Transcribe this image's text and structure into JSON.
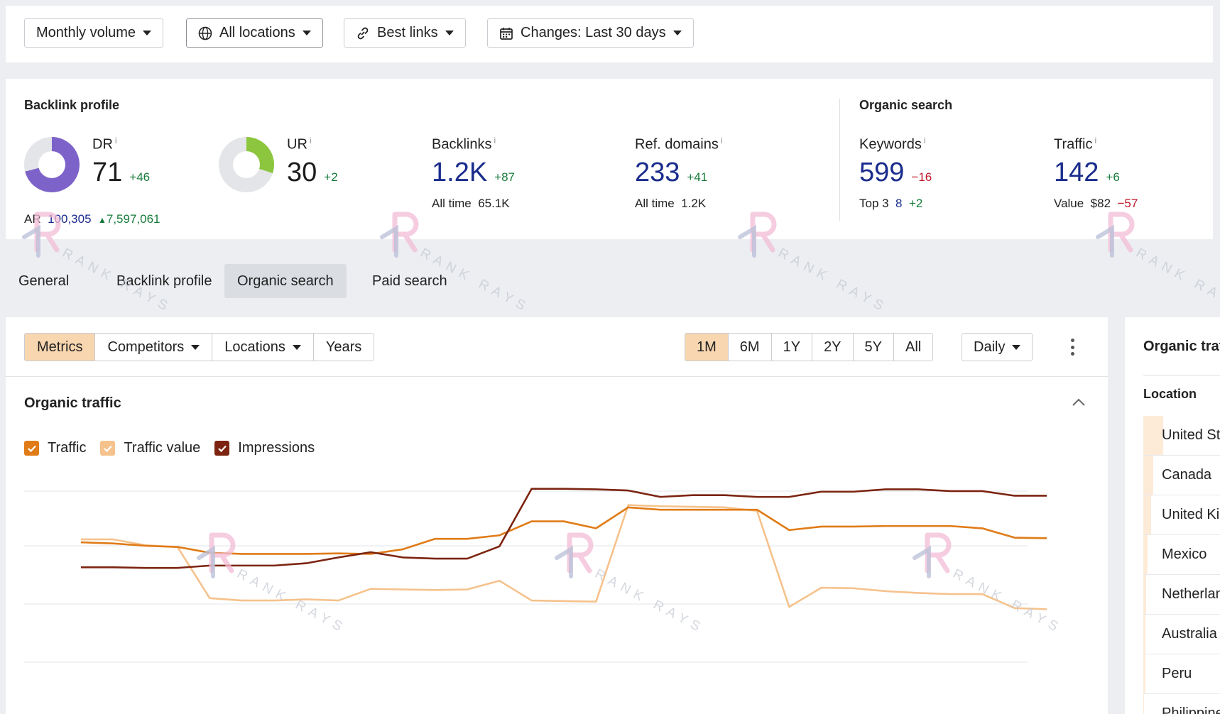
{
  "filters": {
    "volume": "Monthly volume",
    "locations": "All locations",
    "links": "Best links",
    "changes": "Changes: Last 30 days"
  },
  "backlink_profile": {
    "title": "Backlink profile",
    "dr": {
      "label": "DR",
      "value": "71",
      "delta": "+46",
      "fraction": 0.71,
      "color": "#7d63c9"
    },
    "ar": {
      "label": "AR",
      "value": "100,305",
      "delta": "7,597,061"
    },
    "ur": {
      "label": "UR",
      "value": "30",
      "delta": "+2",
      "fraction": 0.3,
      "color": "#8cc63f"
    },
    "backlinks": {
      "label": "Backlinks",
      "value": "1.2K",
      "delta": "+87",
      "sub_label": "All time",
      "sub_value": "65.1K"
    },
    "ref_domains": {
      "label": "Ref. domains",
      "value": "233",
      "delta": "+41",
      "sub_label": "All time",
      "sub_value": "1.2K"
    }
  },
  "organic_search": {
    "title": "Organic search",
    "keywords": {
      "label": "Keywords",
      "value": "599",
      "delta": "−16",
      "sub_label": "Top 3",
      "sub_value": "8",
      "sub_delta": "+2"
    },
    "traffic": {
      "label": "Traffic",
      "value": "142",
      "delta": "+6",
      "sub_label": "Value",
      "sub_value": "$82",
      "sub_delta": "−57"
    }
  },
  "tabs": [
    {
      "label": "General"
    },
    {
      "label": "Backlink profile"
    },
    {
      "label": "Organic search",
      "active": true
    },
    {
      "label": "Paid search"
    }
  ],
  "toolbar": {
    "views": [
      "Metrics",
      "Competitors",
      "Locations",
      "Years"
    ],
    "ranges": [
      "1M",
      "6M",
      "1Y",
      "2Y",
      "5Y",
      "All"
    ],
    "interval": "Daily"
  },
  "organic_traffic": {
    "title": "Organic traffic",
    "legend": [
      {
        "label": "Traffic",
        "color": "#e07b17"
      },
      {
        "label": "Traffic value",
        "color": "#f5c28c"
      },
      {
        "label": "Impressions",
        "color": "#7c2410"
      }
    ]
  },
  "chart_data": {
    "type": "line",
    "x": [
      1,
      2,
      3,
      4,
      5,
      6,
      7,
      8,
      9,
      10,
      11,
      12,
      13,
      14,
      15,
      16,
      17,
      18,
      19,
      20,
      21,
      22,
      23,
      24,
      25,
      26,
      27,
      28,
      29,
      30,
      31
    ],
    "ylim": [
      0,
      3
    ],
    "grid": true,
    "series": [
      {
        "name": "Traffic",
        "color": "#e07b17",
        "values": [
          2.06,
          2.04,
          2.0,
          1.98,
          1.88,
          1.86,
          1.86,
          1.86,
          1.87,
          1.86,
          1.94,
          2.12,
          2.12,
          2.18,
          2.42,
          2.42,
          2.3,
          2.66,
          2.62,
          2.62,
          2.62,
          2.62,
          2.27,
          2.33,
          2.33,
          2.34,
          2.34,
          2.34,
          2.3,
          2.14,
          2.13
        ]
      },
      {
        "name": "Traffic value",
        "color": "#f5c28c",
        "values": [
          2.11,
          2.11,
          2.01,
          1.98,
          1.1,
          1.06,
          1.06,
          1.08,
          1.06,
          1.26,
          1.25,
          1.24,
          1.25,
          1.4,
          1.06,
          1.05,
          1.04,
          2.7,
          2.68,
          2.67,
          2.66,
          2.6,
          0.95,
          1.28,
          1.27,
          1.22,
          1.19,
          1.17,
          1.17,
          0.93,
          0.91
        ]
      },
      {
        "name": "Impressions",
        "color": "#7c2410",
        "values": [
          1.63,
          1.63,
          1.62,
          1.62,
          1.66,
          1.66,
          1.66,
          1.7,
          1.8,
          1.89,
          1.8,
          1.78,
          1.78,
          1.99,
          2.98,
          2.98,
          2.97,
          2.95,
          2.84,
          2.87,
          2.87,
          2.84,
          2.84,
          2.93,
          2.93,
          2.97,
          2.97,
          2.94,
          2.94,
          2.86,
          2.86
        ]
      }
    ]
  },
  "locations_panel": {
    "title": "Organic traffic by location",
    "column": "Location",
    "rows": [
      {
        "name": "United States",
        "share": 0.2
      },
      {
        "name": "Canada",
        "share": 0.1
      },
      {
        "name": "United Kingdom",
        "share": 0.08
      },
      {
        "name": "Mexico",
        "share": 0.04
      },
      {
        "name": "Netherlands",
        "share": 0.03
      },
      {
        "name": "Australia",
        "share": 0.02
      },
      {
        "name": "Peru",
        "share": 0.02
      },
      {
        "name": "Philippines",
        "share": 0.01
      }
    ]
  },
  "watermark": {
    "text": "RANK RAYS"
  }
}
